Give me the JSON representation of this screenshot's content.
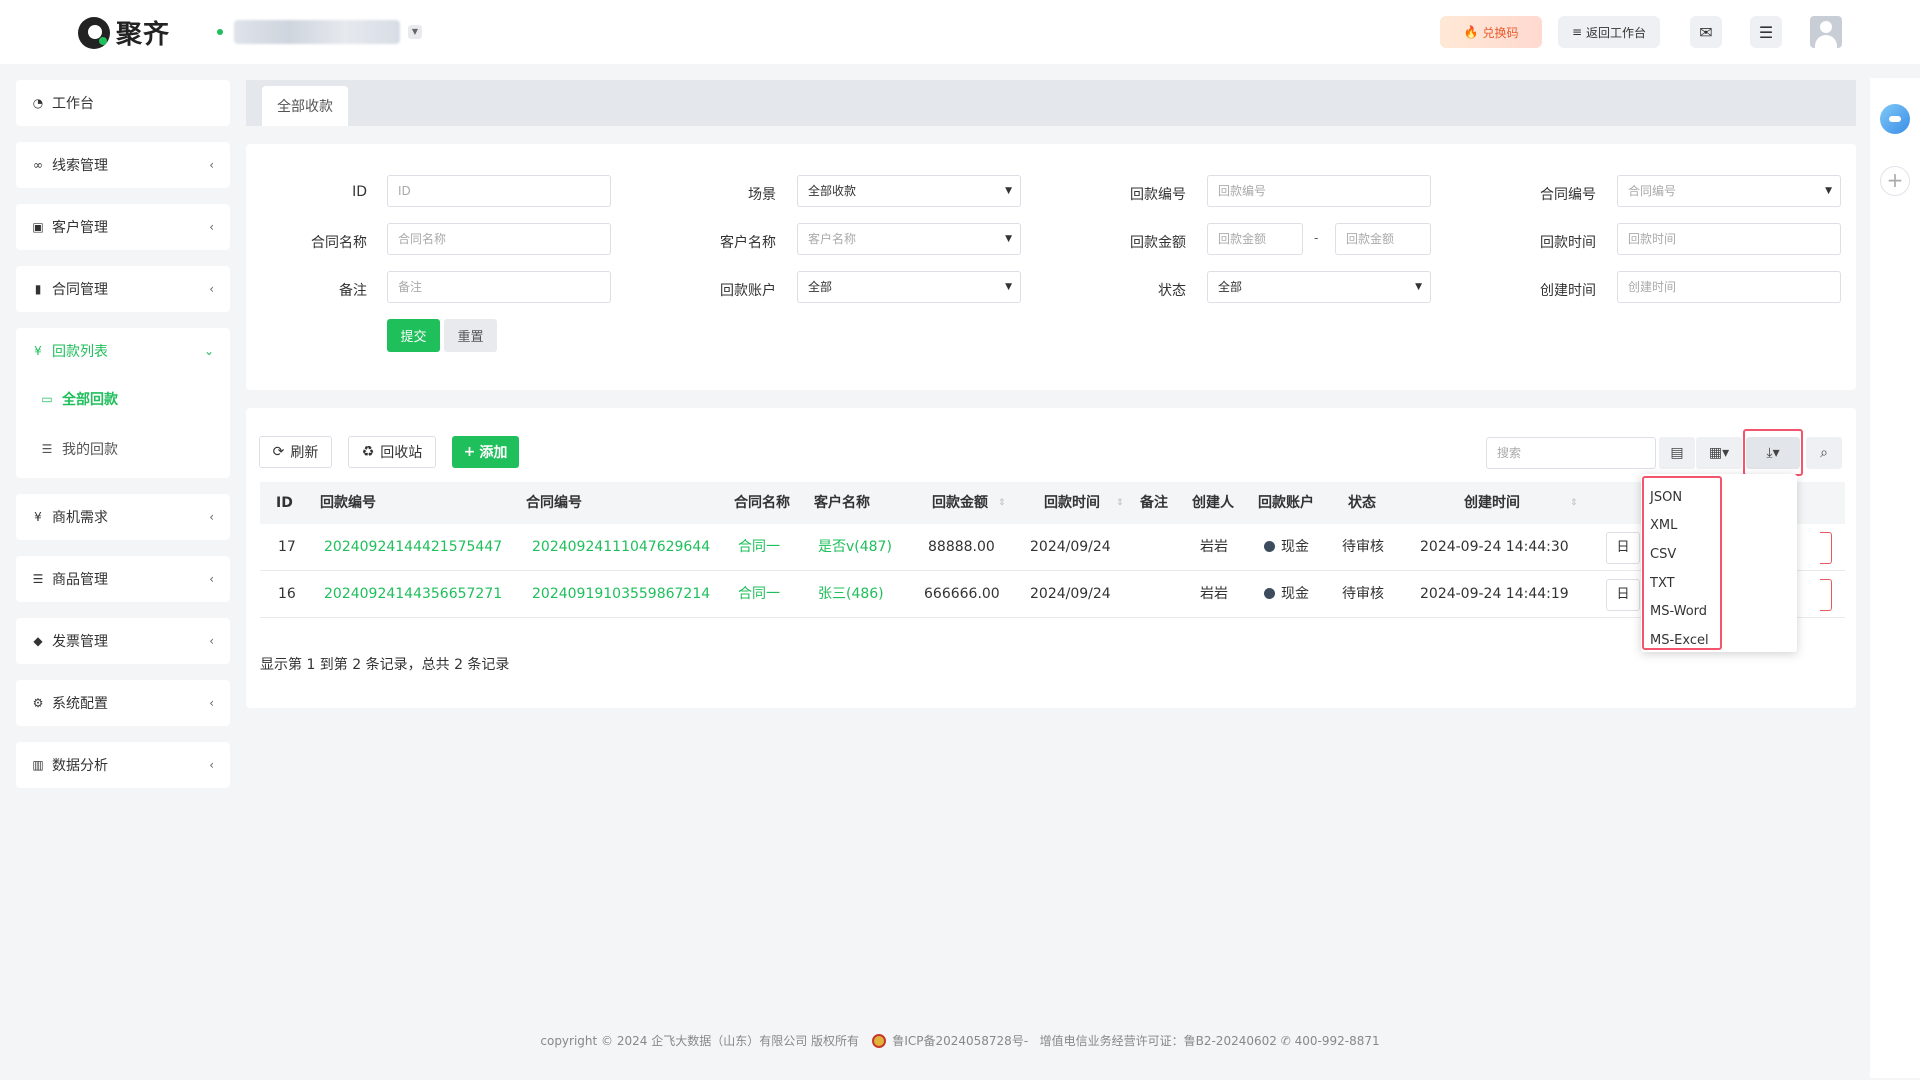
{
  "header": {
    "brand": "聚齐",
    "redeem_label": "兑换码",
    "back_label": "返回工作台"
  },
  "sidebar": {
    "items": [
      {
        "label": "工作台",
        "icon": "dashboard-icon"
      },
      {
        "label": "线索管理",
        "icon": "link-icon"
      },
      {
        "label": "客户管理",
        "icon": "id-card-icon"
      },
      {
        "label": "合同管理",
        "icon": "bookmark-icon"
      },
      {
        "label": "回款列表",
        "icon": "yen-icon",
        "expanded": true,
        "children": [
          {
            "label": "全部回款",
            "icon": "money-icon",
            "active": true
          },
          {
            "label": "我的回款",
            "icon": "list-icon"
          }
        ]
      },
      {
        "label": "商机需求",
        "icon": "yen-icon"
      },
      {
        "label": "商品管理",
        "icon": "list-icon"
      },
      {
        "label": "发票管理",
        "icon": "tag-icon"
      },
      {
        "label": "系统配置",
        "icon": "gears-icon"
      },
      {
        "label": "数据分析",
        "icon": "bar-chart-icon"
      }
    ]
  },
  "tabs": [
    {
      "label": "全部收款"
    }
  ],
  "filter": {
    "fields": [
      {
        "label": "ID",
        "placeholder": "ID"
      },
      {
        "label": "场景",
        "value": "全部收款"
      },
      {
        "label": "回款编号",
        "placeholder": "回款编号"
      },
      {
        "label": "合同编号",
        "placeholder": "合同编号"
      },
      {
        "label": "合同名称",
        "placeholder": "合同名称"
      },
      {
        "label": "客户名称",
        "placeholder": "客户名称"
      },
      {
        "label": "回款金额",
        "placeholder_min": "回款金额",
        "placeholder_max": "回款金额",
        "separator": "-"
      },
      {
        "label": "回款时间",
        "placeholder": "回款时间"
      },
      {
        "label": "备注",
        "placeholder": "备注"
      },
      {
        "label": "回款账户",
        "value": "全部"
      },
      {
        "label": "状态",
        "value": "全部"
      },
      {
        "label": "创建时间",
        "placeholder": "创建时间"
      }
    ],
    "submit_label": "提交",
    "reset_label": "重置"
  },
  "toolbar": {
    "refresh_label": "刷新",
    "recycle_label": "回收站",
    "add_label": "添加",
    "search_placeholder": "搜索"
  },
  "table": {
    "columns": [
      "ID",
      "回款编号",
      "合同编号",
      "合同名称",
      "客户名称",
      "回款金额",
      "回款时间",
      "备注",
      "创建人",
      "回款账户",
      "状态",
      "创建时间"
    ],
    "rows": [
      {
        "id": "17",
        "receipt_no": "20240924144421575447",
        "contract_no": "20240924111047629644",
        "contract_name": "合同一",
        "customer": "是否v(487)",
        "amount": "88888.00",
        "time": "2024/09/24",
        "note": "",
        "creator": "岩岩",
        "account": "现金",
        "status": "待审核",
        "created": "2024-09-24 14:44:30",
        "op": "日"
      },
      {
        "id": "16",
        "receipt_no": "20240924144356657271",
        "contract_no": "20240919103559867214",
        "contract_name": "合同一",
        "customer": "张三(486)",
        "amount": "666666.00",
        "time": "2024/09/24",
        "note": "",
        "creator": "岩岩",
        "account": "现金",
        "status": "待审核",
        "created": "2024-09-24 14:44:19",
        "op": "日"
      }
    ],
    "pagination": "显示第 1 到第 2 条记录，总共 2 条记录"
  },
  "export_menu": {
    "options": [
      "JSON",
      "XML",
      "CSV",
      "TXT",
      "MS-Word",
      "MS-Excel"
    ]
  },
  "footer": {
    "copyright": "copyright © 2024 企飞大数据（山东）有限公司 版权所有",
    "icp": "鲁ICP备2024058728号-",
    "license": "增值电信业务经营许可证：鲁B2-20240602",
    "phone": "400-992-8871"
  },
  "colors": {
    "accent": "#1fbf5b",
    "highlight": "#f2556c"
  }
}
